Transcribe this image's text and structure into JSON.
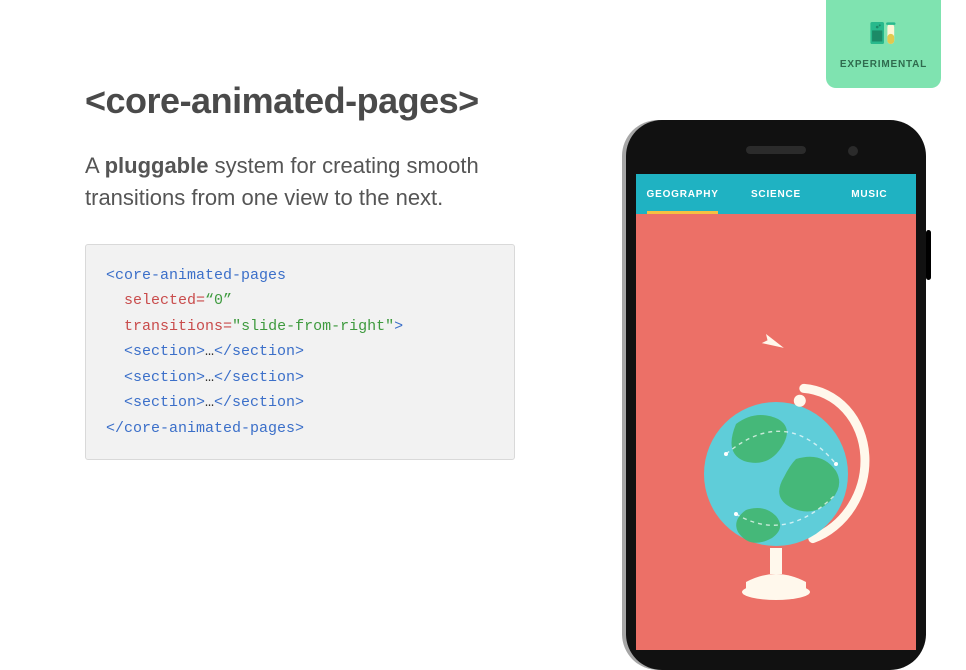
{
  "badge": {
    "label": "EXPERIMENTAL"
  },
  "hero": {
    "title": "<core-animated-pages>",
    "subtitle_pre": "A ",
    "subtitle_bold": "pluggable",
    "subtitle_post": " system for creating smooth transitions from one view to the next."
  },
  "code": {
    "open_tag": "<core-animated-pages",
    "attr1_name": "selected",
    "attr1_eq": "=",
    "attr1_val": "“0”",
    "attr2_name": "transitions",
    "attr2_eq": "=",
    "attr2_val": "\"slide-from-right\"",
    "open_close": ">",
    "section_open": "<section>",
    "section_body": "…",
    "section_close": "</section>",
    "close_tag": "</core-animated-pages>"
  },
  "phone": {
    "tabs": [
      {
        "label": "GEOGRAPHY",
        "active": true
      },
      {
        "label": "SCIENCE",
        "active": false
      },
      {
        "label": "MUSIC",
        "active": false
      }
    ]
  }
}
